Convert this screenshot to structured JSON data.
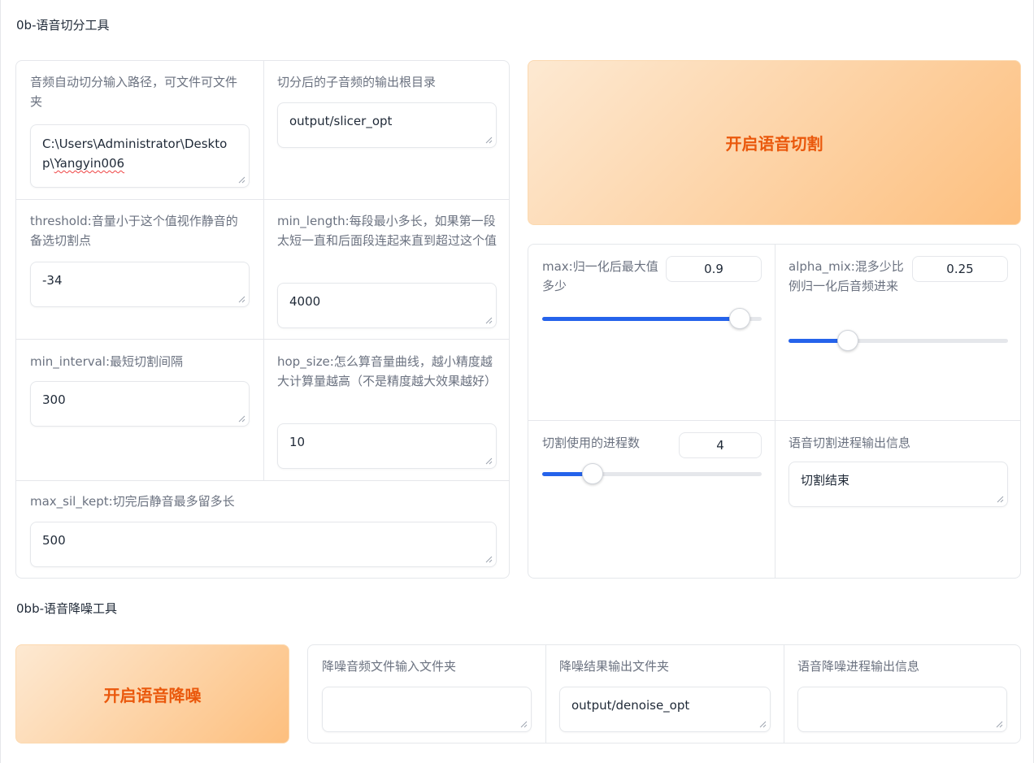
{
  "slicer": {
    "title": "0b-语音切分工具",
    "input_path": {
      "label": "音频自动切分输入路径，可文件可文件夹",
      "value_part1": "C:\\Users\\Administrator\\Deskto",
      "value_part2_prefix": "p\\",
      "value_part2_word": "Yangyin006"
    },
    "output_root": {
      "label": "切分后的子音频的输出根目录",
      "value": "output/slicer_opt"
    },
    "threshold": {
      "label": "threshold:音量小于这个值视作静音的备选切割点",
      "value": "-34"
    },
    "min_length": {
      "label": "min_length:每段最小多长，如果第一段太短一直和后面段连起来直到超过这个值",
      "value": "4000"
    },
    "min_interval": {
      "label": "min_interval:最短切割间隔",
      "value": "300"
    },
    "hop_size": {
      "label": "hop_size:怎么算音量曲线，越小精度越大计算量越高（不是精度越大效果越好）",
      "value": "10"
    },
    "max_sil_kept": {
      "label": "max_sil_kept:切完后静音最多留多长",
      "value": "500"
    },
    "start_button": "开启语音切割",
    "max": {
      "label": "max:归一化后最大值多少",
      "value": "0.9",
      "fraction": 0.9
    },
    "alpha_mix": {
      "label": "alpha_mix:混多少比例归一化后音频进来",
      "value": "0.25",
      "fraction": 0.27
    },
    "processes": {
      "label": "切割使用的进程数",
      "value": "4",
      "fraction": 0.23
    },
    "info": {
      "label": "语音切割进程输出信息",
      "value": "切割结束"
    }
  },
  "denoise": {
    "title": "0bb-语音降噪工具",
    "start_button": "开启语音降噪",
    "input_dir": {
      "label": "降噪音频文件输入文件夹",
      "value": ""
    },
    "output_dir": {
      "label": "降噪结果输出文件夹",
      "value": "output/denoise_opt"
    },
    "info": {
      "label": "语音降噪进程输出信息",
      "value": ""
    }
  },
  "colors": {
    "accent": "#ea580c",
    "slider": "#2563eb",
    "button_from": "#fde9d2",
    "button_to": "#fdbf7e"
  }
}
